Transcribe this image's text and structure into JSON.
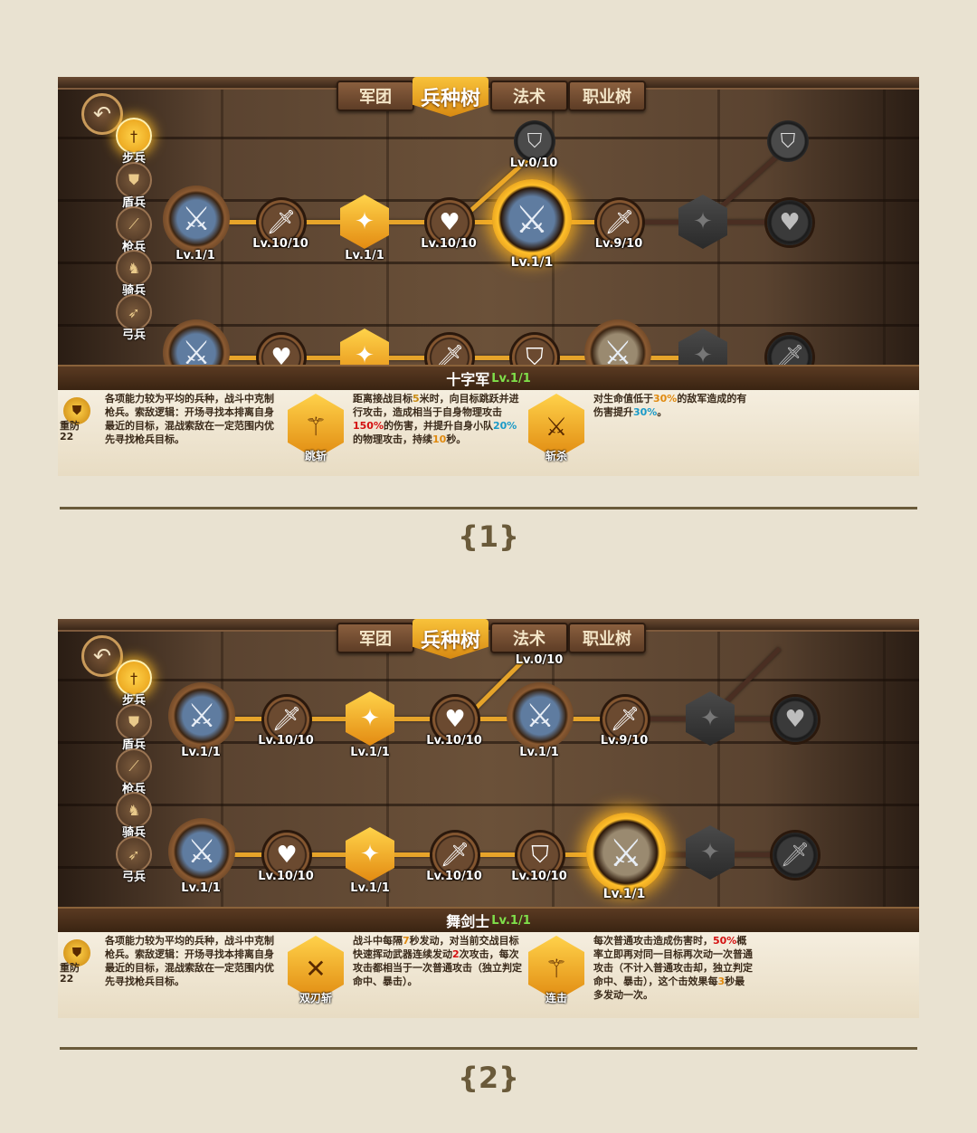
{
  "colors": {
    "accent": "#e6a42a",
    "background": "#e9e2d1",
    "divider": "#6a5a3a"
  },
  "tabs": [
    "军团",
    "兵种树",
    "法术",
    "职业树"
  ],
  "categories": [
    "步兵",
    "盾兵",
    "枪兵",
    "骑兵",
    "弓兵"
  ],
  "back_icon": "back-arrow-icon",
  "armor_label": "重防",
  "armor_value": "22",
  "base_desc": "各项能力较为平均的兵种，战斗中克制枪兵。索敌逻辑：开场寻找本排离自身最近的目标，混战索敌在一定范围内优先寻找枪兵目标。",
  "screens": [
    {
      "caption": "{1}",
      "unit_name": "十字军",
      "unit_level": "Lv.1/1",
      "row1_levels": [
        "Lv.1/1",
        "Lv.10/10",
        "Lv.1/1",
        "Lv.10/10",
        "Lv.1/1",
        "Lv.9/10"
      ],
      "branch_level": "Lv.0/10",
      "skill1_name": "跳斩",
      "skill1_desc": [
        "距离接战目标",
        "5",
        "米时，向目标跳跃并进行攻击，造成相当于自身物理攻击",
        "150%",
        "的伤害，并提升自身小队",
        "20%",
        "的物理攻击，持续",
        "10",
        "秒。"
      ],
      "skill2_name": "斩杀",
      "skill2_desc": [
        "对生命值低于",
        "30%",
        "的敌军造成的有伤害提升",
        "30%",
        "。"
      ]
    },
    {
      "caption": "{2}",
      "unit_name": "舞剑士",
      "unit_level": "Lv.1/1",
      "row1_levels": [
        "Lv.1/1",
        "Lv.10/10",
        "Lv.1/1",
        "Lv.10/10",
        "Lv.1/1",
        "Lv.9/10"
      ],
      "row2_levels": [
        "Lv.1/1",
        "Lv.10/10",
        "Lv.1/1",
        "Lv.10/10",
        "Lv.10/10",
        "Lv.1/1"
      ],
      "branch_level": "Lv.0/10",
      "skill1_name": "双刃斩",
      "skill1_desc": [
        "战斗中每隔",
        "7",
        "秒发动，对当前交战目标快速挥动武器连续发动",
        "2",
        "次攻击，每次攻击都相当于一次普通攻击（独立判定命中、暴击）。"
      ],
      "skill2_name": "连击",
      "skill2_desc": [
        "每次普通攻击造成伤害时，",
        "50%",
        "概率立即再对同一目标再次动一次普通攻击（不计入普通攻击却，独立判定命中、暴击），这个击效果每",
        "3",
        "秒最多发动一次。"
      ]
    }
  ]
}
